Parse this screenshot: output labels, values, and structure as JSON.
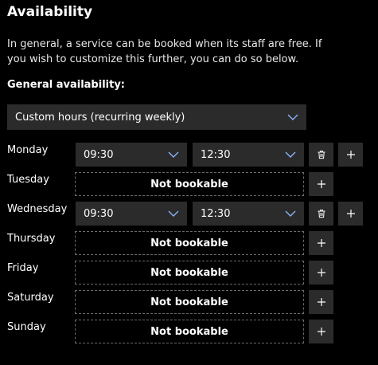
{
  "header": {
    "title": "Availability",
    "description": "In general, a service can be booked when its staff are free. If you wish to customize this further, you can do so below."
  },
  "general": {
    "label": "General availability:",
    "selected": "Custom hours (recurring weekly)"
  },
  "days": [
    {
      "name": "Monday",
      "bookable": true,
      "start": "09:30",
      "end": "12:30"
    },
    {
      "name": "Tuesday",
      "bookable": false,
      "status": "Not bookable"
    },
    {
      "name": "Wednesday",
      "bookable": true,
      "start": "09:30",
      "end": "12:30"
    },
    {
      "name": "Thursday",
      "bookable": false,
      "status": "Not bookable"
    },
    {
      "name": "Friday",
      "bookable": false,
      "status": "Not bookable"
    },
    {
      "name": "Saturday",
      "bookable": false,
      "status": "Not bookable"
    },
    {
      "name": "Sunday",
      "bookable": false,
      "status": "Not bookable"
    }
  ],
  "icons": {
    "chevron": "chevron-down-icon",
    "delete": "trash-icon",
    "add": "plus-icon"
  },
  "colors": {
    "background": "#000000",
    "control": "#2b2b2b",
    "dashed_border": "#6a6a6a",
    "chevron": "#8ab4f8"
  }
}
